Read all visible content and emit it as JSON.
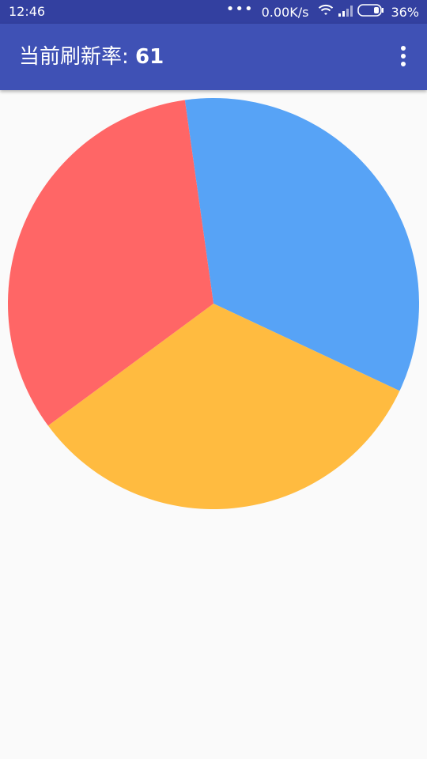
{
  "status_bar": {
    "time": "12:46",
    "dots": "•••",
    "network_speed": "0.00K/s",
    "battery_level": "36%",
    "icons": [
      "wifi-icon",
      "signal-icon",
      "battery-icon"
    ]
  },
  "app_bar": {
    "title_label": "当前刷新率: ",
    "title_value": "61",
    "color": "#3F51B5",
    "menu_icon": "overflow-menu-icon"
  },
  "chart_data": {
    "type": "pie",
    "title": "",
    "start_angle_deg": -8,
    "slices": [
      {
        "value": 34.2,
        "color": "#57A3F6"
      },
      {
        "value": 32.9,
        "color": "#FFBB40"
      },
      {
        "value": 32.9,
        "color": "#FF6666"
      }
    ],
    "legend": "none"
  }
}
